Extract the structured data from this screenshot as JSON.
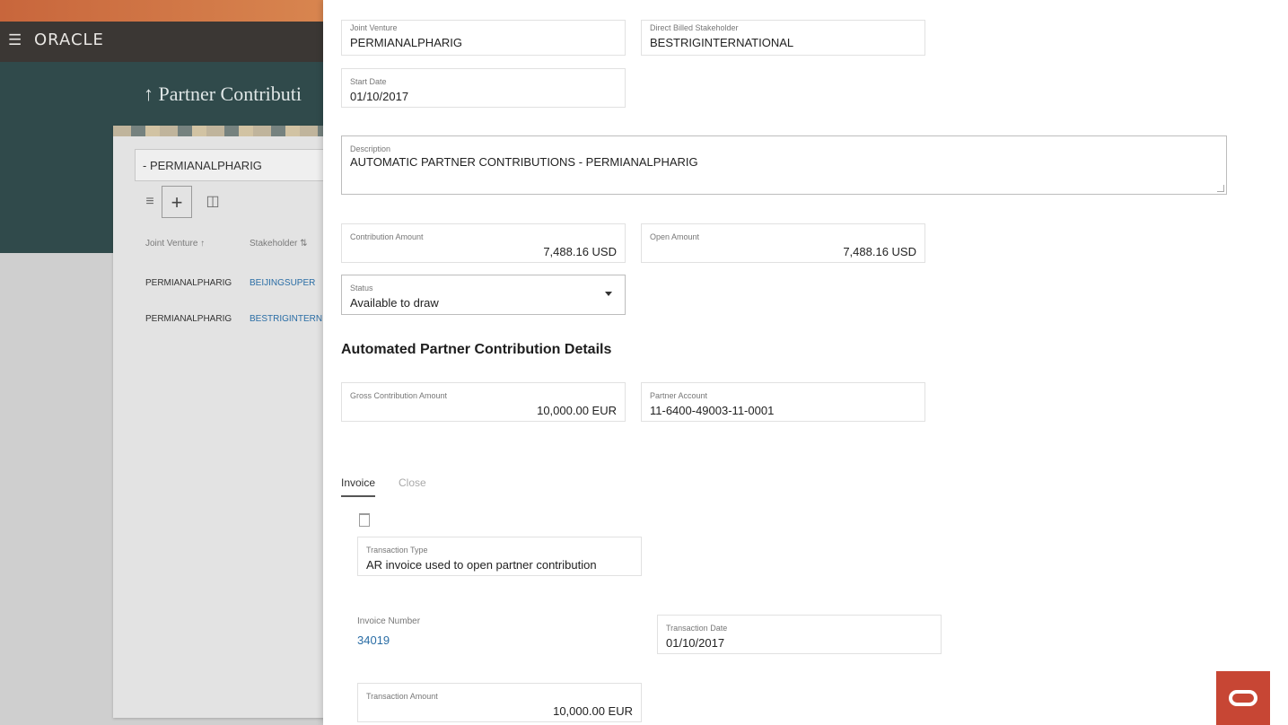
{
  "app": {
    "logo": "ORACLE",
    "menu_icon": "hamburger-icon",
    "page_title": "↑  Partner Contributi"
  },
  "list_panel": {
    "joint_venture_value": "- PERMIANALPHARIG",
    "toolbar": {
      "filter_icon": "filter-icon",
      "add_icon": "+",
      "delete_icon": "trash-icon"
    },
    "columns": [
      "Joint Venture  ↑",
      "Stakeholder  ⇅"
    ],
    "rows": [
      {
        "joint_venture": "PERMIANALPHARIG",
        "stakeholder": "BEIJINGSUPER"
      },
      {
        "joint_venture": "PERMIANALPHARIG",
        "stakeholder": "BESTRIGINTERN"
      }
    ]
  },
  "detail": {
    "joint_venture": {
      "label": "Joint Venture",
      "value": "PERMIANALPHARIG"
    },
    "direct_billed": {
      "label": "Direct Billed Stakeholder",
      "value": "BESTRIGINTERNATIONAL"
    },
    "start_date": {
      "label": "Start Date",
      "value": "01/10/2017"
    },
    "description": {
      "label": "Description",
      "value": "AUTOMATIC PARTNER CONTRIBUTIONS - PERMIANALPHARIG"
    },
    "contribution_amount": {
      "label": "Contribution Amount",
      "value": "7,488.16 USD"
    },
    "open_amount": {
      "label": "Open Amount",
      "value": "7,488.16 USD"
    },
    "status": {
      "label": "Status",
      "value": "Available to draw"
    },
    "section_title": "Automated Partner Contribution Details",
    "gross_amount": {
      "label": "Gross Contribution Amount",
      "value": "10,000.00 EUR"
    },
    "partner_account": {
      "label": "Partner Account",
      "value": "11-6400-49003-11-0001"
    },
    "tabs": [
      "Invoice",
      "Close"
    ],
    "transaction_type": {
      "label": "Transaction Type",
      "value": "AR invoice used to open partner contribution"
    },
    "invoice_number": {
      "label": "Invoice Number",
      "value": "34019"
    },
    "transaction_date": {
      "label": "Transaction Date",
      "value": "01/10/2017"
    },
    "transaction_amount": {
      "label": "Transaction Amount",
      "value": "10,000.00 EUR"
    }
  },
  "colors": {
    "brand_red": "#c74634",
    "hero_teal": "#304a4b",
    "link_blue": "#2a6da5"
  }
}
